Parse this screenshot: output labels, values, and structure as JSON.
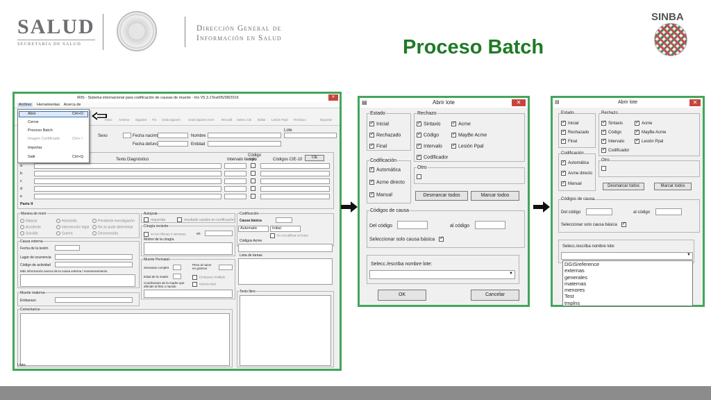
{
  "header": {
    "salud_logo": "SALUD",
    "salud_subtitle": "SECRETARÍA DE SALUD",
    "dgis_line1": "Dirección General de",
    "dgis_line2": "Información en Salud",
    "sinba_logo": "SINBA",
    "slide_title": "Proceso Batch"
  },
  "iris": {
    "title": "IRIS - Sistema internacional para codificación de causas de muerte - Iris V5.3.1Test/05/08/2016",
    "menu": [
      "Archivo",
      "Herramientas",
      "Acerca de"
    ],
    "toolbar": [
      "Inicio",
      "Anterior",
      "Siguient",
      "Fin",
      "Grab.siguient",
      "Grab.siguient recH",
      "Recodif.",
      "Selecc CB",
      "Editar",
      "Lesión Ppal",
      "Rechazo",
      "Exportar"
    ],
    "dropdown": [
      {
        "label": "Abrir",
        "shortcut": "Ctrl+O"
      },
      {
        "label": "Cerrar",
        "shortcut": ""
      },
      {
        "label": "Proceso Batch",
        "shortcut": ""
      },
      {
        "label": "Imagen Certificado",
        "shortcut": "Ctrl+ I"
      },
      {
        "label": "Importar",
        "shortcut": ""
      },
      {
        "label": "Salir",
        "shortcut": "Ctrl+Q"
      }
    ],
    "fields": {
      "sexo": "Sexo",
      "fecha_nacimiento": "Fecha nacimto",
      "nombre": "Nombre",
      "lote": "Lote",
      "fecha_defuncion": "Fecha defunc",
      "entidad": "Entidad"
    },
    "texto_diagnostico": "Texto Diagnóstico",
    "intervalo": "Intervalo tiempo",
    "codigo_solo": "Código solo",
    "codigos_cie": "Códigos CIE-10",
    "cie_button": "CIE",
    "rows": [
      "a",
      "b",
      "c",
      "d",
      "e",
      "Parte II"
    ],
    "manera_muerte": {
      "title": "Manera de morir",
      "options": [
        "Natural",
        "Homicidio",
        "Pendiente investigación",
        "Accidente",
        "Intervención legal",
        "No se pudo determinar",
        "Suicidio",
        "Guerra",
        "Desconocida"
      ]
    },
    "autopsia": {
      "title": "Autopsia",
      "requerida": "requerida",
      "resultado": "resultado usados en certificación"
    },
    "codificacion": {
      "title": "Codificación",
      "causa_basica": "Causa básica",
      "automatic": "Automatic",
      "initial": "Initial",
      "no_recod": "No recodificar en lotes",
      "codigos_acme": "Códigos Acme",
      "lista_tareas": "Lista de tareas"
    },
    "cirugia": {
      "title": "Cirugía reciente",
      "ultimas": "en las últimas 4 semanas",
      "en": "en",
      "motivo": "Motivo de la cirugía"
    },
    "causa_externa": {
      "title": "Causa externa",
      "fecha_lesion": "Fecha de la lesión",
      "lugar": "Lugar de ocurrencia",
      "codigo_actividad": "Código de actividad",
      "mas_info": "Más información acerca de la causa externa / envenenamiento"
    },
    "muerte_perinatal": {
      "title": "Muerte Perinatal",
      "semanas": "Semanas complet",
      "peso": "Peso al nacer en gramos",
      "edad_madre": "Edad de la madre",
      "embarazo": "Embarazo múltiple",
      "condiciones": "Condiciones de la madre que afectan al feto o nacido",
      "muerte_fetal": "Muerte fetal"
    },
    "muerte_materna": {
      "title": "Muerte materna",
      "embarazo": "Embarazo"
    },
    "comentarios": "Comentarios",
    "texto_libre": "Texto libre",
    "status": "Listo"
  },
  "abrir_lote_1": {
    "title": "Abrir lote",
    "estado": {
      "title": "Estado",
      "items": [
        {
          "label": "Inicial",
          "checked": true
        },
        {
          "label": "Rechazado",
          "checked": true
        },
        {
          "label": "Final",
          "checked": true
        }
      ]
    },
    "rechazo": {
      "title": "Rechazo",
      "col1": [
        {
          "label": "Sintaxis",
          "checked": true
        },
        {
          "label": "Código",
          "checked": true
        },
        {
          "label": "Intervalo",
          "checked": true
        },
        {
          "label": "Codificador",
          "checked": true
        }
      ],
      "col2": [
        {
          "label": "Acme",
          "checked": true
        },
        {
          "label": "MayBe Acme",
          "checked": true
        },
        {
          "label": "Lesión Ppal",
          "checked": true
        }
      ]
    },
    "codificacion": {
      "title": "Codificación",
      "items": [
        {
          "label": "Automática",
          "checked": true
        },
        {
          "label": "Acme directo",
          "checked": true
        },
        {
          "label": "Manual",
          "checked": true
        }
      ]
    },
    "otro": "Otro",
    "desmarcar": "Desmarcar todos",
    "marcar": "Marcar todos",
    "codigos_causa": "Códigos de causa",
    "del_codigo": "Del código",
    "al_codigo": "al código",
    "solo_basica": "Seleccionar solo causa básica",
    "selecc_lote": "Selecc./escriba nombre lote:",
    "ok": "OK",
    "cancelar": "Cancelar"
  },
  "abrir_lote_2": {
    "title": "Abrir lote",
    "lote_options": [
      "DGISreference",
      "externas",
      "generales",
      "maternas",
      "menores",
      "Test",
      "tmplns"
    ]
  },
  "colors": {
    "green_frame": "#42a65a",
    "title_green": "#1e7a25",
    "close_red": "#c9453c"
  }
}
